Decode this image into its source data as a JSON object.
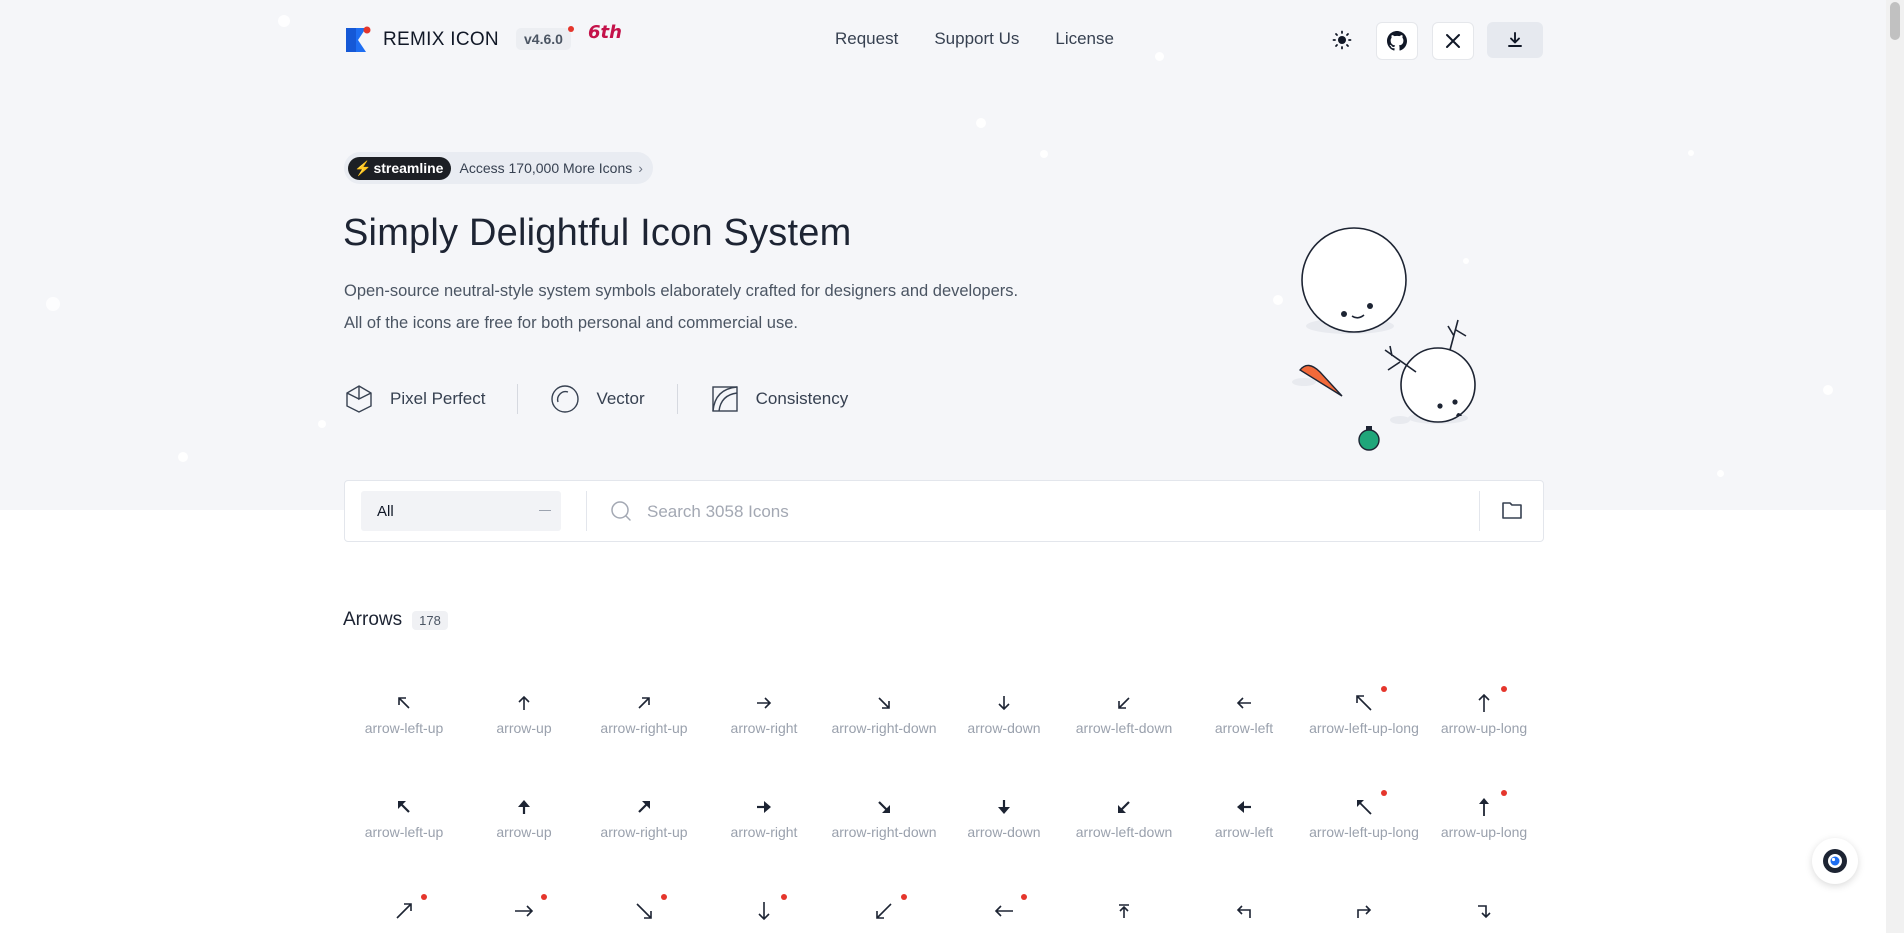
{
  "header": {
    "logo_text": "REMIX ICON",
    "version": "v4.6.0",
    "anniversary": "6th",
    "nav": [
      "Request",
      "Support Us",
      "License"
    ]
  },
  "promo": {
    "brand": "streamline",
    "text": "Access 170,000 More Icons"
  },
  "hero": {
    "title": "Simply Delightful Icon System",
    "line1": "Open-source neutral-style system symbols elaborately crafted for designers and developers.",
    "line2": "All of the icons are free for both personal and commercial use.",
    "features": [
      {
        "label": "Pixel Perfect",
        "icon": "cube-icon"
      },
      {
        "label": "Vector",
        "icon": "circle-icon"
      },
      {
        "label": "Consistency",
        "icon": "square-curve-icon"
      }
    ]
  },
  "search": {
    "category": "All",
    "placeholder": "Search 3058 Icons"
  },
  "section": {
    "title": "Arrows",
    "count": "178"
  },
  "icons_row1": [
    {
      "name": "arrow-left-up",
      "glyph": "↖"
    },
    {
      "name": "arrow-up",
      "glyph": "↑"
    },
    {
      "name": "arrow-right-up",
      "glyph": "↗"
    },
    {
      "name": "arrow-right",
      "glyph": "→"
    },
    {
      "name": "arrow-right-down",
      "glyph": "↘"
    },
    {
      "name": "arrow-down",
      "glyph": "↓"
    },
    {
      "name": "arrow-left-down",
      "glyph": "↙"
    },
    {
      "name": "arrow-left",
      "glyph": "←"
    },
    {
      "name": "arrow-left-up-long",
      "glyph": "↖",
      "new": true
    },
    {
      "name": "arrow-up-long",
      "glyph": "↑",
      "new": true
    }
  ],
  "icons_row2": [
    {
      "name": "arrow-left-up",
      "glyph": "⬉"
    },
    {
      "name": "arrow-up",
      "glyph": "⬆"
    },
    {
      "name": "arrow-right-up",
      "glyph": "⬈"
    },
    {
      "name": "arrow-right",
      "glyph": "➔"
    },
    {
      "name": "arrow-right-down",
      "glyph": "⬊"
    },
    {
      "name": "arrow-down",
      "glyph": "⬇"
    },
    {
      "name": "arrow-left-down",
      "glyph": "⬋"
    },
    {
      "name": "arrow-left",
      "glyph": "⬅"
    },
    {
      "name": "arrow-left-up-long",
      "glyph": "⬉",
      "new": true
    },
    {
      "name": "arrow-up-long",
      "glyph": "⬆",
      "new": true
    }
  ],
  "icons_row3": [
    {
      "glyph": "↗",
      "new": true
    },
    {
      "glyph": "→",
      "new": true
    },
    {
      "glyph": "↘",
      "new": true
    },
    {
      "glyph": "↓",
      "new": true
    },
    {
      "glyph": "↙",
      "new": true
    },
    {
      "glyph": "←",
      "new": true
    },
    {
      "glyph": "↥"
    },
    {
      "glyph": "↰"
    },
    {
      "glyph": "↱"
    },
    {
      "glyph": "↴"
    }
  ],
  "colors": {
    "brand_blue": "#1e6ef2",
    "accent_red": "#e5362c",
    "text_dark": "#1d2433",
    "muted": "#9aa1ad"
  }
}
